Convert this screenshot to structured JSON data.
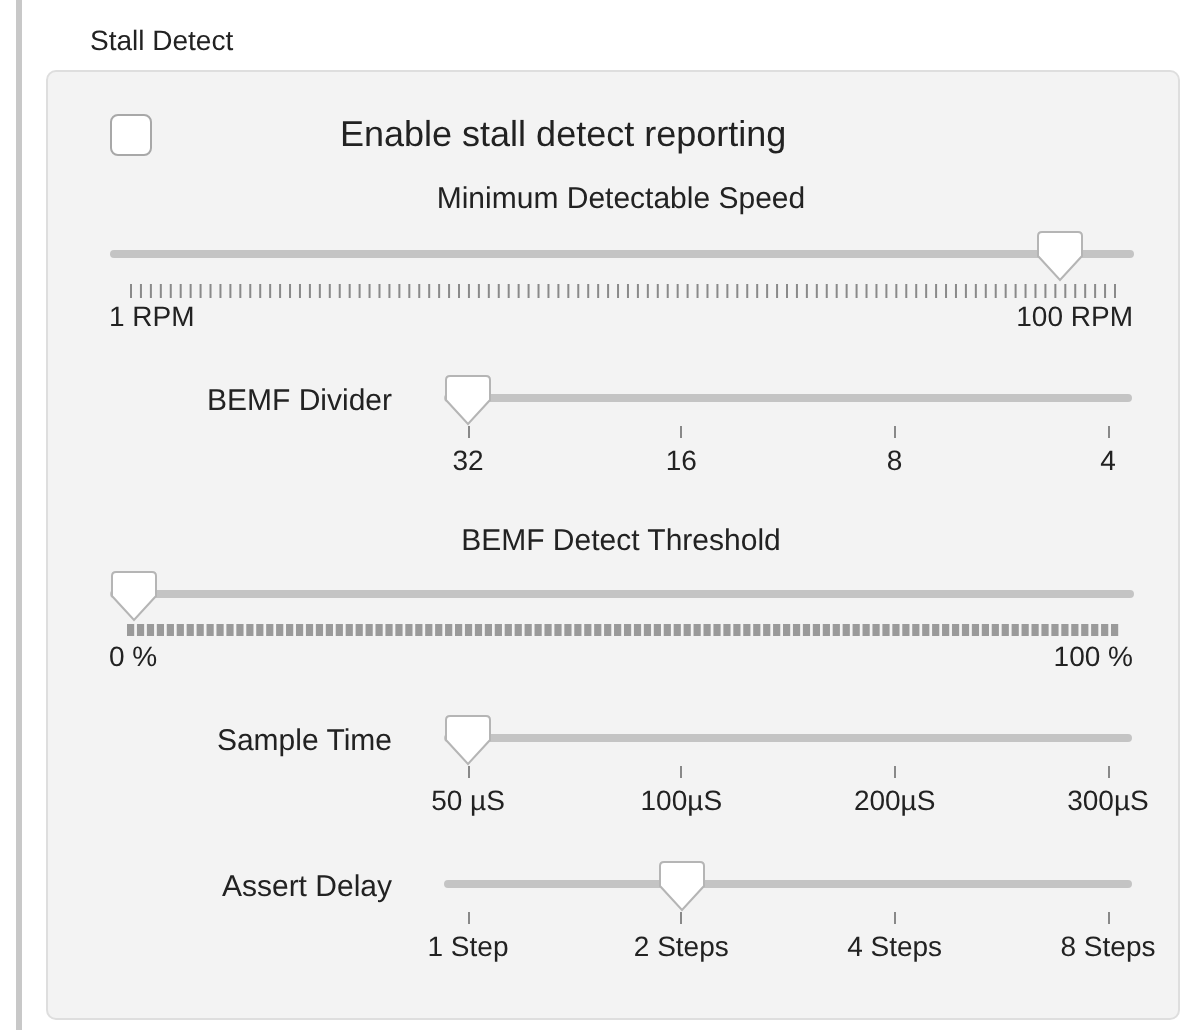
{
  "group": {
    "title": "Stall Detect"
  },
  "enable": {
    "label": "Enable stall detect reporting",
    "checked": false
  },
  "sliders": [
    {
      "kind": "fine",
      "label": "Minimum Detectable Speed",
      "level": 0.95,
      "min_label": "1 RPM",
      "max_label": "100 RPM"
    },
    {
      "kind": "inline",
      "label": "BEMF Divider",
      "level": 0,
      "tick_labels": [
        "32",
        "16",
        "8",
        "4"
      ]
    },
    {
      "kind": "dense",
      "label": "BEMF Detect Threshold",
      "level": 0,
      "min_label": "0 %",
      "max_label": "100 %"
    },
    {
      "kind": "inline",
      "label": "Sample Time",
      "level": 0,
      "tick_labels": [
        "50 µS",
        "100µS",
        "200µS",
        "300µS"
      ]
    },
    {
      "kind": "inline",
      "label": "Assert Delay",
      "level": 0.333,
      "tick_labels": [
        "1 Step",
        "2 Steps",
        "4 Steps",
        "8 Steps"
      ]
    }
  ]
}
